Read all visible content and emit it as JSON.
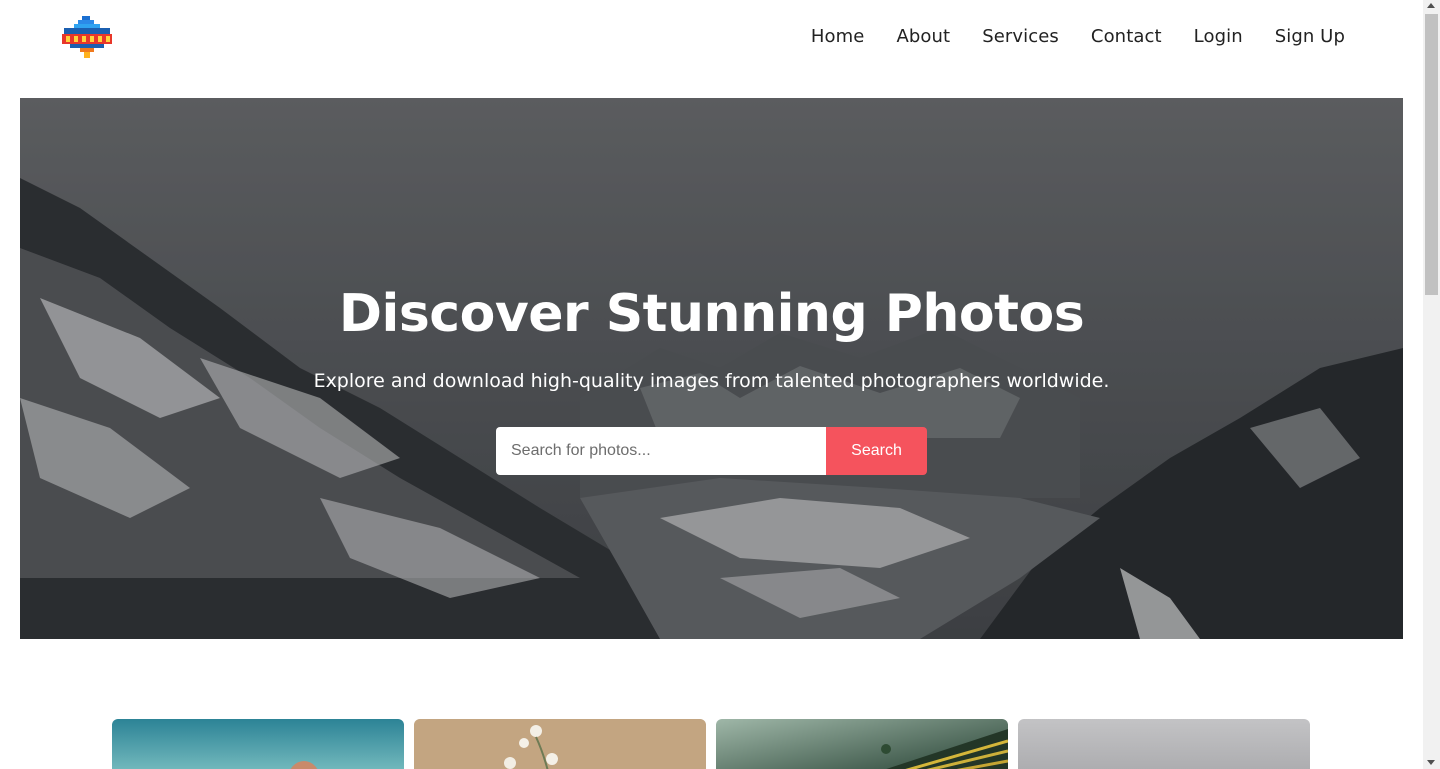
{
  "brand": {
    "logo_text": "PIXELS",
    "logo_icon": "pixel-logo-icon"
  },
  "nav": {
    "items": [
      {
        "label": "Home"
      },
      {
        "label": "About"
      },
      {
        "label": "Services"
      },
      {
        "label": "Contact"
      },
      {
        "label": "Login"
      },
      {
        "label": "Sign Up"
      }
    ]
  },
  "hero": {
    "title": "Discover Stunning Photos",
    "subtitle": "Explore and download high-quality images from talented photographers worldwide.",
    "search": {
      "placeholder": "Search for photos...",
      "value": "",
      "button_label": "Search"
    },
    "background": "snowy-mountain-valley-photo"
  },
  "gallery": {
    "photos": [
      {
        "subject": "hot-air-balloon-teal-sky"
      },
      {
        "subject": "white-flowers-on-wood"
      },
      {
        "subject": "green-terraced-hills"
      },
      {
        "subject": "grey-misty-sky"
      }
    ]
  },
  "colors": {
    "accent": "#f5535d",
    "text": "#222222",
    "hero_overlay": "#4d5054"
  }
}
